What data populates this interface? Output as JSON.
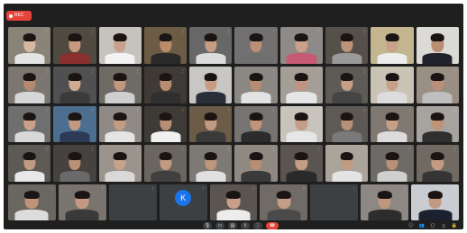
{
  "rec_badge": {
    "label": "REC"
  },
  "tiles": [
    {
      "name": "",
      "mic": "⋮",
      "wall": "#8a8378",
      "skin": "#d9b8a2",
      "shirt": "#e4e4e4"
    },
    {
      "name": "",
      "mic": "⋮",
      "wall": "#514a40",
      "skin": "#c79a7f",
      "shirt": "#8b2f2f"
    },
    {
      "name": "",
      "mic": "⋮",
      "wall": "#c6c2bc",
      "skin": "#c9a08b",
      "shirt": "#f2f2f2"
    },
    {
      "name": "",
      "mic": "⋮",
      "wall": "#6d5c45",
      "skin": "#b98d6c",
      "shirt": "#2a2a2a"
    },
    {
      "name": "",
      "mic": "⋮",
      "wall": "#676767",
      "skin": "#c69d82",
      "shirt": "#dcdcdc"
    },
    {
      "name": "",
      "mic": "⋮",
      "wall": "#727070",
      "skin": "#b98f77",
      "shirt": "#6f6f6f"
    },
    {
      "name": "",
      "mic": "⋮",
      "wall": "#8e8a87",
      "skin": "#caa089",
      "shirt": "#c65b73"
    },
    {
      "name": "",
      "mic": "⋮",
      "wall": "#55504a",
      "skin": "#bd9379",
      "shirt": "#9a9a9a"
    },
    {
      "name": "",
      "mic": "⋮",
      "wall": "#c2b590",
      "skin": "#c9a186",
      "shirt": "#ececec"
    },
    {
      "name": "",
      "mic": "⋮",
      "wall": "#dcdad6",
      "skin": "#b98e72",
      "shirt": "#20232c"
    },
    {
      "name": "",
      "mic": "⋮",
      "wall": "#7c7670",
      "skin": "#b48a6f",
      "shirt": "#d6d6d6"
    },
    {
      "name": "",
      "mic": "⋮",
      "wall": "#505050",
      "skin": "#d1aa91",
      "shirt": "#3a3a3a"
    },
    {
      "name": "",
      "mic": "⋮",
      "wall": "#6e6a64",
      "skin": "#c29780",
      "shirt": "#cfcfcf"
    },
    {
      "name": "",
      "mic": "⋮",
      "wall": "#3f3a35",
      "skin": "#b78c70",
      "shirt": "#303030"
    },
    {
      "name": "",
      "mic": "⋮",
      "wall": "#c9c7c4",
      "skin": "#c69c83",
      "shirt": "#2a2e38"
    },
    {
      "name": "",
      "mic": "⋮",
      "wall": "#8b8884",
      "skin": "#b68c73",
      "shirt": "#e2e2e2"
    },
    {
      "name": "",
      "mic": "⋮",
      "wall": "#a49e96",
      "skin": "#c09480",
      "shirt": "#e6e6e6"
    },
    {
      "name": "",
      "mic": "⋮",
      "wall": "#5e5b57",
      "skin": "#c79e86",
      "shirt": "#454545"
    },
    {
      "name": "",
      "mic": "⋮",
      "wall": "#c9c3b5",
      "skin": "#c7a08a",
      "shirt": "#dcdcdc"
    },
    {
      "name": "",
      "mic": "⋮",
      "wall": "#9a8f83",
      "skin": "#b9907a",
      "shirt": "#bfbfbf"
    },
    {
      "name": "",
      "mic": "⋮",
      "wall": "#6f6f6f",
      "skin": "#caa089",
      "shirt": "#d8d8d8"
    },
    {
      "name": "",
      "mic": "⋮",
      "wall": "#4d6f8f",
      "skin": "#c39a80",
      "shirt": "#2c3a55"
    },
    {
      "name": "",
      "mic": "⋮",
      "wall": "#8f8a86",
      "skin": "#c49c84",
      "shirt": "#e4e4e4"
    },
    {
      "name": "",
      "mic": "⋮",
      "wall": "#3e3a36",
      "skin": "#b68e74",
      "shirt": "#f0f0f0"
    },
    {
      "name": "",
      "mic": "⋮",
      "wall": "#6b5b47",
      "skin": "#c29a82",
      "shirt": "#3a3a3a"
    },
    {
      "name": "",
      "mic": "⋮",
      "wall": "#777371",
      "skin": "#bf9479",
      "shirt": "#2c2c2c"
    },
    {
      "name": "",
      "mic": "⋮",
      "wall": "#c8c4bc",
      "skin": "#c39d87",
      "shirt": "#e6e6e6"
    },
    {
      "name": "",
      "mic": "⋮",
      "wall": "#5e5954",
      "skin": "#b98f75",
      "shirt": "#7a7a7a"
    },
    {
      "name": "",
      "mic": "⋮",
      "wall": "#7e7870",
      "skin": "#c89e86",
      "shirt": "#dcdcdc"
    },
    {
      "name": "",
      "mic": "⋮",
      "wall": "#a7a39f",
      "skin": "#bd9479",
      "shirt": "#2f2f2f"
    },
    {
      "name": "",
      "mic": "⋮",
      "wall": "#5d5a56",
      "skin": "#c09a82",
      "shirt": "#e8e8e8"
    },
    {
      "name": "",
      "mic": "⋮",
      "wall": "#454240",
      "skin": "#b98f75",
      "shirt": "#6a6a6a"
    },
    {
      "name": "",
      "mic": "⋮",
      "wall": "#9a948d",
      "skin": "#c9a28b",
      "shirt": "#d9d9d9"
    },
    {
      "name": "",
      "mic": "⋮",
      "wall": "#6a655f",
      "skin": "#c29982",
      "shirt": "#404040"
    },
    {
      "name": "",
      "mic": "⋮",
      "wall": "#7d7975",
      "skin": "#be967e",
      "shirt": "#e0e0e0"
    },
    {
      "name": "",
      "mic": "⋮",
      "wall": "#8f8982",
      "skin": "#b88d72",
      "shirt": "#3a3a3a"
    },
    {
      "name": "",
      "mic": "⋮",
      "wall": "#5a5550",
      "skin": "#c59d85",
      "shirt": "#2a2a2a"
    },
    {
      "name": "",
      "mic": "⋮",
      "wall": "#aaa49b",
      "skin": "#c29b83",
      "shirt": "#e4e4e4"
    },
    {
      "name": "",
      "mic": "⋮",
      "wall": "#6e6a66",
      "skin": "#b98f76",
      "shirt": "#cfcfcf"
    },
    {
      "name": "",
      "mic": "⋮",
      "wall": "#706a62",
      "skin": "#c49a82",
      "shirt": "#353535"
    }
  ],
  "bottom_tiles": [
    {
      "type": "video",
      "name": "",
      "mic": "⋮",
      "wall": "#6a6660",
      "skin": "#bd9379",
      "shirt": "#dcdcdc"
    },
    {
      "type": "video",
      "name": "",
      "mic": "⋮",
      "wall": "#7a746e",
      "skin": "#c39a81",
      "shirt": "#3a3a3a"
    },
    {
      "type": "blank",
      "name": "",
      "mic": "⋮",
      "wall": "#3c4043"
    },
    {
      "type": "avatar",
      "letter": "K",
      "name": "",
      "mic": "⋮",
      "wall": "#3c4043"
    },
    {
      "type": "video",
      "name": "",
      "mic": "⋮",
      "wall": "#5a5550",
      "skin": "#c8a08a",
      "shirt": "#ececec"
    },
    {
      "type": "video",
      "name": "",
      "mic": "⋮",
      "wall": "#706b66",
      "skin": "#c49d86",
      "shirt": "#4a4a4a"
    },
    {
      "type": "blank",
      "name": "",
      "mic": "⋮",
      "wall": "#3c4043"
    },
    {
      "type": "video",
      "name": "",
      "mic": "⋮",
      "wall": "#8e8884",
      "skin": "#bf967e",
      "shirt": "#2d2d2d"
    },
    {
      "type": "video",
      "name": "",
      "mic": "⋮",
      "wall": "#c9ccd1",
      "skin": "#c29a82",
      "shirt": "#1c2130"
    }
  ],
  "bottombar": {
    "clock": "",
    "controls": [
      {
        "icon": "mic-icon",
        "glyph": "🎙"
      },
      {
        "icon": "camera-icon",
        "glyph": "▭"
      },
      {
        "icon": "captions-icon",
        "glyph": "▤"
      },
      {
        "icon": "present-icon",
        "glyph": "⇧"
      },
      {
        "icon": "more-icon",
        "glyph": "⋮"
      }
    ],
    "hangup_glyph": "☎",
    "right_controls": [
      {
        "icon": "info-icon",
        "glyph": "ⓘ"
      },
      {
        "icon": "people-icon",
        "glyph": "👥"
      },
      {
        "icon": "chat-icon",
        "glyph": "▢"
      },
      {
        "icon": "activities-icon",
        "glyph": "△"
      },
      {
        "icon": "lock-icon",
        "glyph": "🔒"
      }
    ]
  }
}
